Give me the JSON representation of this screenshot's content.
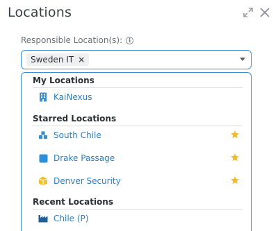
{
  "window": {
    "title": "Locations",
    "expand_icon": "expand-icon",
    "close_icon": "close-icon"
  },
  "field": {
    "label": "Responsible Location(s):",
    "info_icon": "info-icon",
    "selected": [
      {
        "label": "Sweden IT",
        "remove_symbol": "×"
      }
    ]
  },
  "dropdown": {
    "groups": [
      {
        "header": "My Locations",
        "items": [
          {
            "label": "KaiNexus",
            "icon": "building-icon",
            "icon_color": "#3b8fd1",
            "starred": false
          }
        ]
      },
      {
        "header": "Starred Locations",
        "items": [
          {
            "label": "South Chile",
            "icon": "cubes-icon",
            "icon_color": "#3b8fd1",
            "starred": true
          },
          {
            "label": "Drake Passage",
            "icon": "square-icon",
            "icon_color": "#2f8ed8",
            "starred": true
          },
          {
            "label": "Denver Security",
            "icon": "cube-icon",
            "icon_color": "#f2c12e",
            "starred": true
          }
        ]
      },
      {
        "header": "Recent Locations",
        "items": [
          {
            "label": "Chile (P)",
            "icon": "factory-icon",
            "icon_color": "#1f5f99",
            "starred": false
          }
        ]
      }
    ],
    "star_color": "#f2b92e"
  }
}
